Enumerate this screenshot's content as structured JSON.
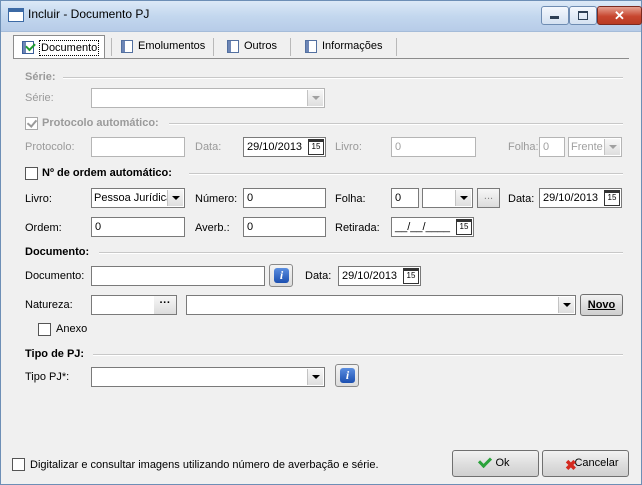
{
  "window": {
    "title": "Incluir - Documento PJ"
  },
  "tabs": [
    {
      "label": "Documento"
    },
    {
      "label": "Emolumentos"
    },
    {
      "label": "Outros"
    },
    {
      "label": "Informações"
    }
  ],
  "serie_group": {
    "header": "Série:",
    "serie_label": "Série:",
    "serie_value": ""
  },
  "protocolo_group": {
    "header": "Protocolo automático:",
    "protocolo_label": "Protocolo:",
    "protocolo_value": "",
    "data_label": "Data:",
    "data_value": "29/10/2013",
    "livro_label": "Livro:",
    "livro_value": "0",
    "folha_label": "Folha:",
    "folha_value": "0",
    "folha_side": "Frente"
  },
  "ordem_group": {
    "header": "Nº de ordem automático:",
    "livro_label": "Livro:",
    "livro_value": "Pessoa Jurídica",
    "numero_label": "Número:",
    "numero_value": "0",
    "folha_label": "Folha:",
    "folha_value": "0",
    "folha_side": "",
    "dots": "...",
    "data_label": "Data:",
    "data_value": "29/10/2013",
    "ordem_label": "Ordem:",
    "ordem_value": "0",
    "averb_label": "Averb.:",
    "averb_value": "0",
    "retirada_label": "Retirada:",
    "retirada_value": "__/__/____"
  },
  "documento_group": {
    "header": "Documento:",
    "documento_label": "Documento:",
    "documento_value": "",
    "data_label": "Data:",
    "data_value": "29/10/2013",
    "natureza_label": "Natureza:",
    "natureza_code": "",
    "natureza_desc": "",
    "dots": "···",
    "novo_label": "Novo",
    "anexo_label": "Anexo"
  },
  "tipo_group": {
    "header": "Tipo de PJ:",
    "tipo_label": "Tipo PJ*:",
    "tipo_value": ""
  },
  "footer": {
    "digitalizar_label": "Digitalizar e consultar imagens utilizando número de averbação e série.",
    "ok_label": "Ok",
    "cancel_label": "Cancelar"
  },
  "calendar_icon_text": "15",
  "info_icon_text": "i",
  "colors": {
    "title_bar": "#c3d7ee",
    "close_button": "#c7462f",
    "info_icon": "#1b4fb0"
  }
}
